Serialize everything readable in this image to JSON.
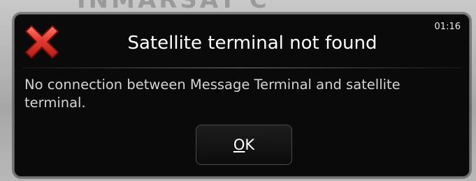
{
  "background": {
    "text": "INMARSAT C"
  },
  "dialog": {
    "title": "Satellite terminal not found",
    "time": "01:16",
    "message": "No connection between Message Terminal and satellite terminal.",
    "ok_mnemonic": "O",
    "ok_rest": "K",
    "icon": "red-x-icon"
  },
  "colors": {
    "icon_red": "#e23a2f",
    "divider": "#5d89a6",
    "dialog_bg": "#0a0a0a"
  }
}
